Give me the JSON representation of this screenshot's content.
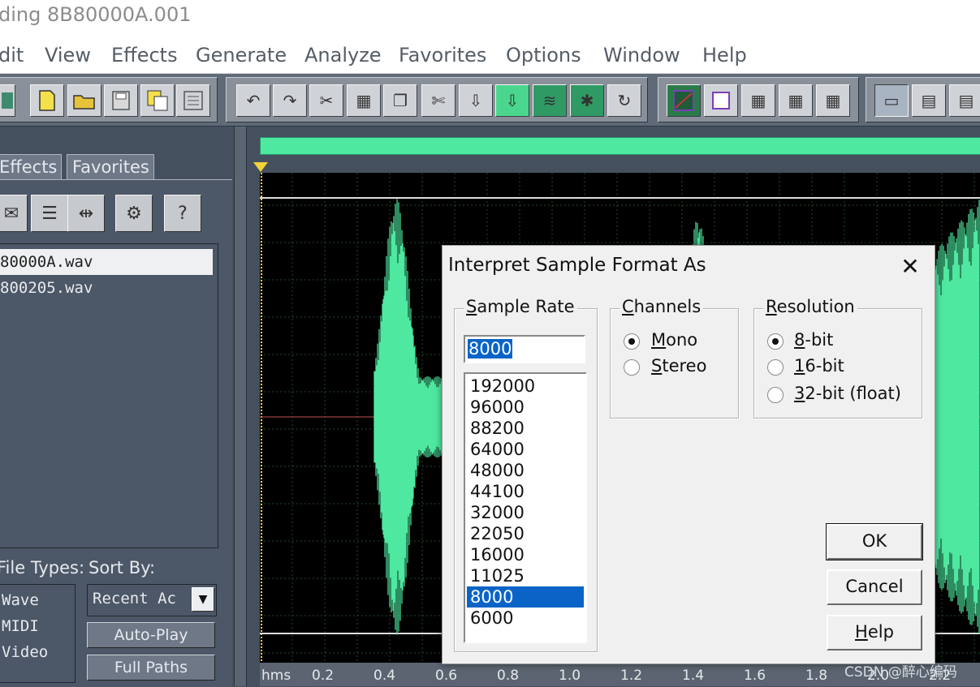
{
  "window": {
    "title": "ding 8B80000A.001",
    "menu": [
      "dit",
      "View",
      "Effects",
      "Generate",
      "Analyze",
      "Favorites",
      "Options",
      "Window",
      "Help"
    ]
  },
  "toolbar": {
    "buttons": [
      "toolbar-icon",
      "new-file-icon",
      "open-folder-icon",
      "save-icon",
      "save-all-icon",
      "batch-icon",
      "undo-icon",
      "redo-icon",
      "trim-icon",
      "mix-paste-icon",
      "copy-icon",
      "cut-icon",
      "paste-icon",
      "paste-new-icon",
      "generate-icon",
      "noise-icon",
      "loop-icon",
      "envelope-icon",
      "view-icon",
      "grid1-icon",
      "grid2-icon",
      "grid3-icon",
      "window1-icon",
      "window2-icon",
      "window3-icon"
    ]
  },
  "organizer": {
    "tabs": [
      "Effects",
      "Favorites"
    ],
    "files": [
      "80000A.wav",
      "800205.wav"
    ],
    "file_types_label": "File Types:",
    "sort_by_label": "Sort By:",
    "file_types": [
      "Wave",
      "MIDI",
      "Video"
    ],
    "sort_value": "Recent Ac",
    "auto_play": "Auto-Play",
    "full_paths": "Full Paths"
  },
  "ruler": {
    "ticks": [
      "hms",
      "0.2",
      "0.4",
      "0.6",
      "0.8",
      "1.0",
      "1.2",
      "1.4",
      "1.6",
      "1.8",
      "2.0",
      "2.2"
    ]
  },
  "dialog": {
    "title": "Interpret Sample Format As",
    "close": "✕",
    "sample_rate": {
      "legend": "Sample Rate",
      "value": "8000",
      "options": [
        "192000",
        "96000",
        "88200",
        "64000",
        "48000",
        "44100",
        "32000",
        "22050",
        "16000",
        "11025",
        "8000",
        "6000"
      ],
      "selected": "8000"
    },
    "channels": {
      "legend": "Channels",
      "options": [
        "Mono",
        "Stereo"
      ],
      "selected": "Mono"
    },
    "resolution": {
      "legend": "Resolution",
      "options": [
        "8-bit",
        "16-bit",
        "32-bit (float)"
      ],
      "selected": "8-bit"
    },
    "buttons": {
      "ok": "OK",
      "cancel": "Cancel",
      "help": "Help"
    }
  },
  "watermark": "CSDN @醉心编码",
  "colors": {
    "waveform": "#4ee8a0",
    "background": "#45505f",
    "selection": "#0a64c8"
  }
}
